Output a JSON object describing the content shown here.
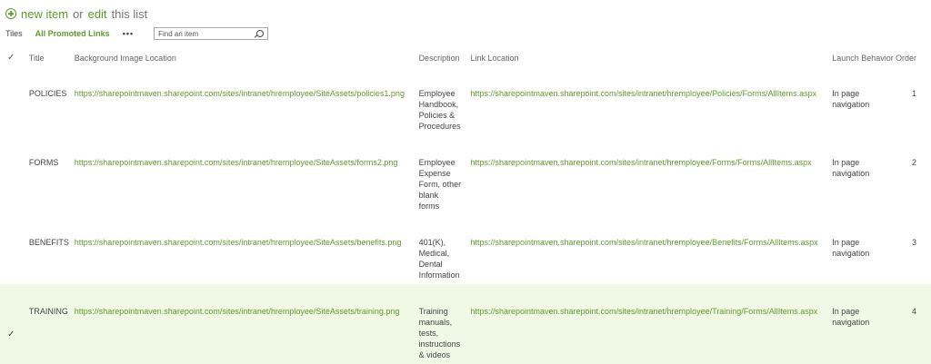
{
  "header": {
    "new_item": "new item",
    "or": "or",
    "edit": "edit",
    "this_list": "this list"
  },
  "views": {
    "tiles": "Tiles",
    "selected": "All Promoted Links",
    "more": "•••"
  },
  "search": {
    "placeholder": "Find an item"
  },
  "columns": {
    "check": "✓",
    "title": "Title",
    "bg_image": "Background Image Location",
    "description": "Description",
    "link": "Link Location",
    "launch": "Launch Behavior",
    "order": "Order"
  },
  "rows": [
    {
      "title": "POLICIES",
      "bg_image": "https://sharepointmaven.sharepoint.com/sites/intranet/hremployee/SiteAssets/policies1.png",
      "description": [
        "Employee",
        "Handbook,",
        "Policies &",
        "Procedures"
      ],
      "link": "https://sharepointmaven.sharepoint.com/sites/intranet/hremployee/Policies/Forms/AllItems.aspx",
      "launch": [
        "In page",
        "navigation"
      ],
      "order": "1"
    },
    {
      "title": "FORMS",
      "bg_image": "https://sharepointmaven.sharepoint.com/sites/intranet/hremployee/SiteAssets/forms2.png",
      "description": [
        "Employee",
        "Expense",
        "Form, other",
        "blank",
        "forms"
      ],
      "link": "https://sharepointmaven.sharepoint.com/sites/intranet/hremployee/Forms/Forms/AllItems.aspx",
      "launch": [
        "In page",
        "navigation"
      ],
      "order": "2"
    },
    {
      "title": "BENEFITS",
      "bg_image": "https://sharepointmaven.sharepoint.com/sites/intranet/hremployee/SiteAssets/benefits.png",
      "description": [
        "401(K),",
        "Medical,",
        "Dental",
        "Information"
      ],
      "link": "https://sharepointmaven.sharepoint.com/sites/intranet/hremployee/Benefits/Forms/AllItems.aspx",
      "launch": [
        "In page",
        "navigation"
      ],
      "order": "3"
    },
    {
      "title": "TRAINING",
      "bg_image": "https://sharepointmaven.sharepoint.com/sites/intranet/hremployee/SiteAssets/training.png",
      "description": [
        "Training",
        "manuals,",
        "tests,",
        "instructions",
        "& videos"
      ],
      "link": "https://sharepointmaven.sharepoint.com/sites/intranet/hremployee/Training/Forms/AllItems.aspx",
      "launch": [
        "In page",
        "navigation"
      ],
      "order": "4",
      "selected_mark": "✓"
    }
  ]
}
